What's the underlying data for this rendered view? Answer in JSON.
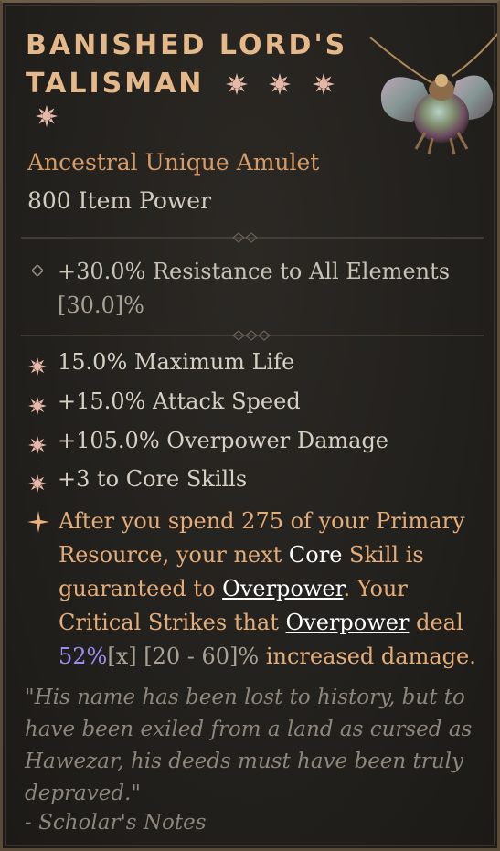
{
  "item": {
    "name_line1": "BANISHED LORD'S",
    "name_line2": "TALISMAN",
    "type": "Ancestral Unique Amulet",
    "item_power": "800 Item Power",
    "implicit_line1": "+30.0% Resistance to All Elements",
    "implicit_line2": "[30.0]%",
    "affixes": [
      {
        "text": "15.0% Maximum Life"
      },
      {
        "text": "+15.0% Attack Speed"
      },
      {
        "text": "+105.0% Overpower Damage"
      },
      {
        "text": "+3 to Core Skills"
      }
    ],
    "legendary": {
      "p1": "After you spend 275 of your Primary Resource, your next ",
      "core": "Core",
      "p2": " Skill is guaranteed to ",
      "overpower1": "Overpower",
      "p3": ". Your Critical Strikes that ",
      "overpower2": "Overpower",
      "p4": " deal ",
      "value": "52%",
      "range": "[x] [20 - 60]%",
      "p5": " increased damage."
    },
    "flavor": "\"His name has been lost to history, but to have been exiled from a land as cursed as Hawezar, his deeds must have been truly depraved.\"",
    "flavor_source": "- Scholar's Notes"
  },
  "colors": {
    "title": "#e5b889",
    "unique": "#d79b68",
    "legendary_text": "#e4ac78",
    "value_highlight": "#9b8cf0",
    "flavor": "#8d867c"
  },
  "icons": {
    "rune": "sun-rune-icon",
    "amulet": "beetle-amulet-icon",
    "implicit_bullet": "diamond-bullet-icon",
    "affix_bullet": "sun-bullet-icon",
    "legendary_bullet": "star-bullet-icon"
  }
}
